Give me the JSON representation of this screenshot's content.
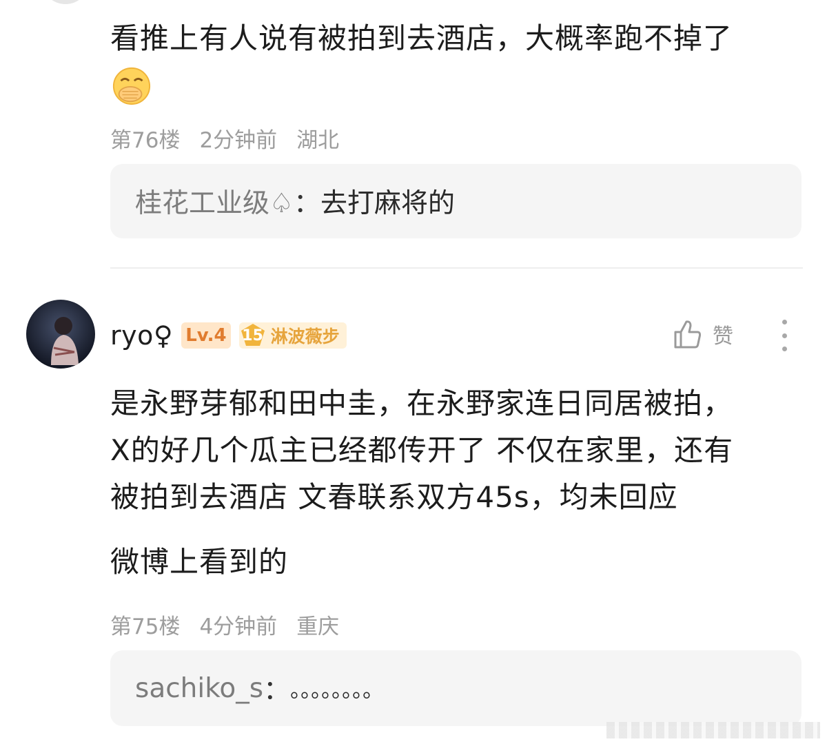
{
  "comment_76": {
    "text": "看推上有人说有被拍到去酒店，大概率跑不掉了",
    "emoji": "covering-mouth-emoji",
    "floor": "第76楼",
    "time": "2分钟前",
    "location": "湖北",
    "reply": {
      "user": "桂花工业级♤",
      "sep": "：",
      "text": "去打麻将的"
    }
  },
  "comment_75": {
    "username": "ryo♀",
    "level": "Lv.4",
    "fan_level": "15",
    "fan_name": "淋波薇步",
    "like_label": "赞",
    "paragraphs": [
      "是永野芽郁和田中圭，在永野家连日同居被拍，",
      "X的好几个瓜主已经都传开了 不仅在家里，还有",
      "被拍到去酒店 文春联系双方45s，均未回应"
    ],
    "extra": "微博上看到的",
    "floor": "第75楼",
    "time": "4分钟前",
    "location": "重庆",
    "reply": {
      "user": "sachiko_s",
      "sep": "：",
      "text": "。。。。。。。。"
    }
  },
  "colors": {
    "meta": "#9d9d9d",
    "reply_bg": "#f5f5f5",
    "level_badge": "#e07c2f",
    "fan_badge": "#e6a43c"
  }
}
